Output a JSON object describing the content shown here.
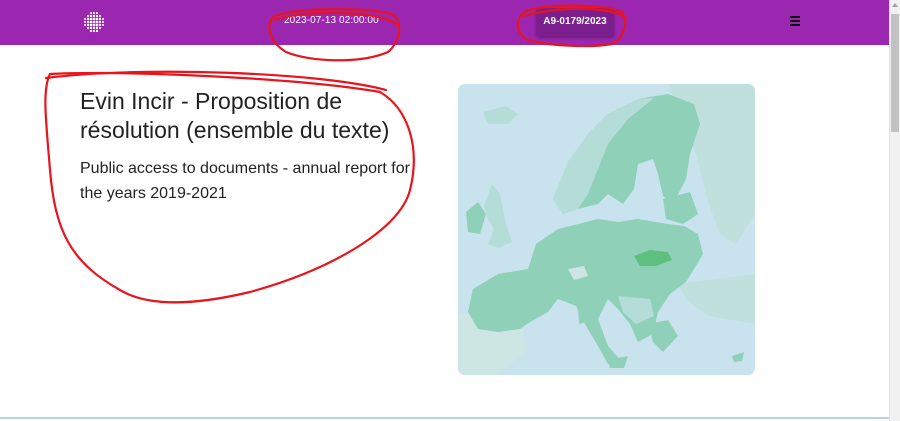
{
  "header": {
    "logo": "dotted-circle-logo",
    "date": "2023-07-13 02:00:00",
    "reference": "A9-0179/2023",
    "menu_icon": "hamburger-menu-icon"
  },
  "main": {
    "title": "Evin Incir - Proposition de résolution (ensemble du texte)",
    "subtitle": "Public access to documents - annual report for the years 2019-2021",
    "map": {
      "description_icon": "europe-map",
      "highlighted_country_color": "#5fbf7f"
    }
  },
  "colors": {
    "header": "#9b27b0",
    "badge": "#7b1f8e",
    "sea": "#c9e3ee",
    "land_eu": "#8fd0b8",
    "land_non_eu": "#b5ddd7",
    "annotation_red": "#e8141c"
  }
}
